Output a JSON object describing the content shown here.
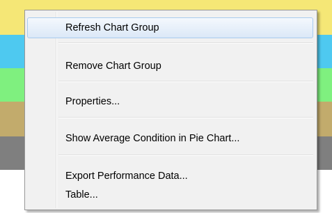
{
  "background_bands": [
    {
      "name": "yellow",
      "color": "#f5e776"
    },
    {
      "name": "cyan",
      "color": "#4ec9f0"
    },
    {
      "name": "green",
      "color": "#7ff07f"
    },
    {
      "name": "tan",
      "color": "#c2ab6c"
    },
    {
      "name": "gray",
      "color": "#7f7f7f"
    }
  ],
  "context_menu": {
    "items": [
      {
        "label": "Refresh Chart Group",
        "highlighted": true
      },
      {
        "label": "Remove Chart Group"
      },
      {
        "label": "Properties..."
      },
      {
        "label": "Show Average Condition in Pie Chart..."
      },
      {
        "label": "Export Performance Data..."
      },
      {
        "label": "Table..."
      }
    ]
  },
  "colors": {
    "menu_background": "#f1f1f1",
    "menu_border": "#979797",
    "highlight_border": "#a8cbee"
  }
}
